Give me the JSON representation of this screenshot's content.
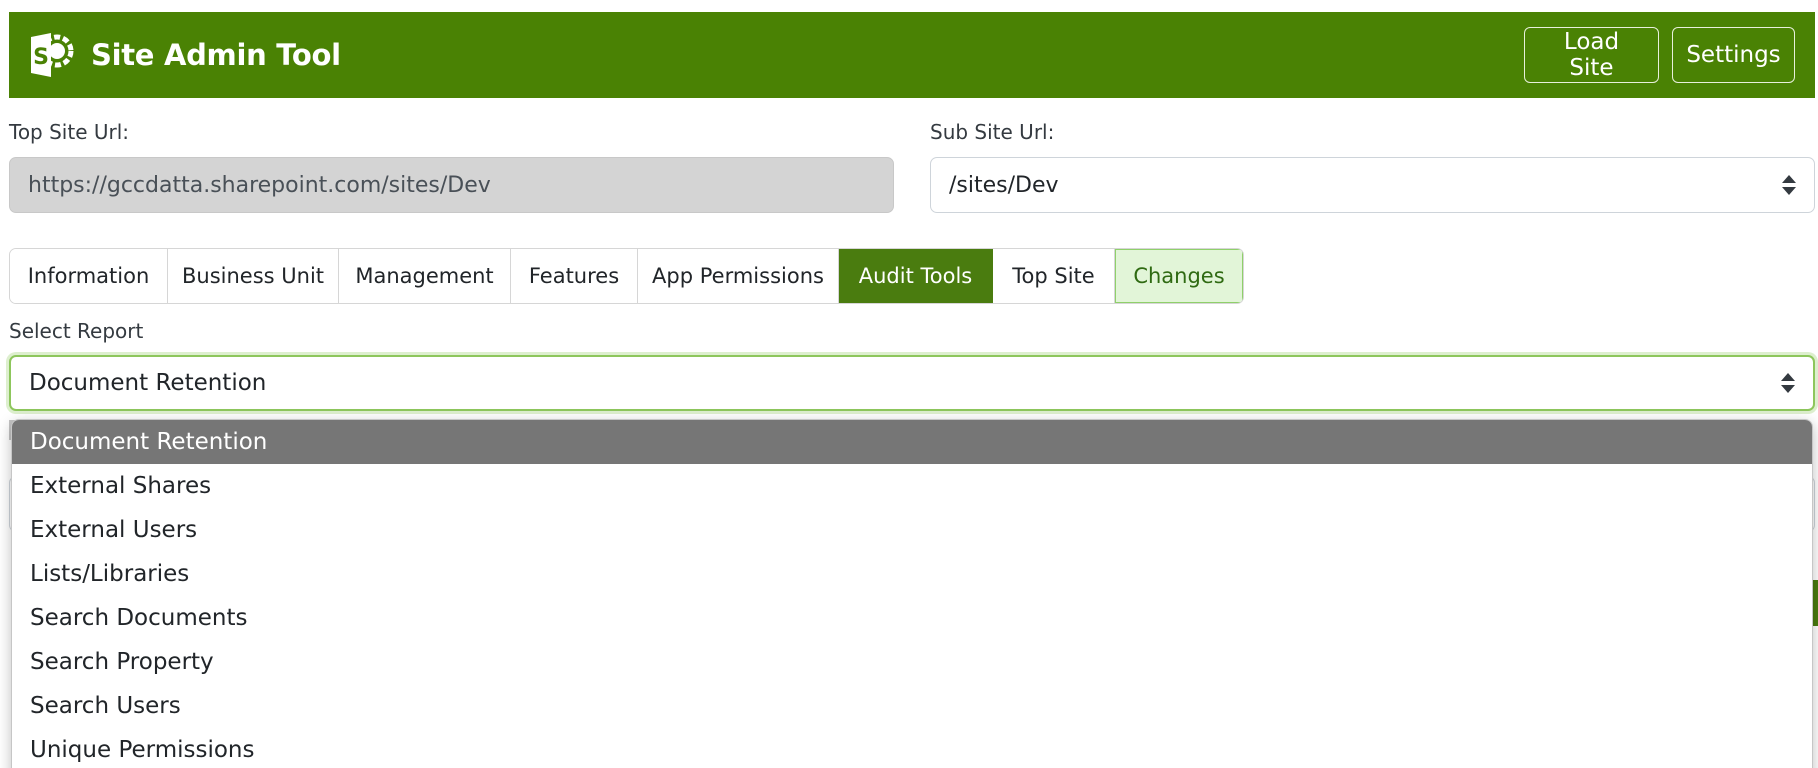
{
  "header": {
    "title": "Site Admin Tool",
    "logo_icon": "sharepoint-logo-icon",
    "load_site_label": "Load Site",
    "settings_label": "Settings",
    "bg_color": "#4a8204"
  },
  "top_site": {
    "label": "Top Site Url:",
    "value": "https://gccdatta.sharepoint.com/sites/Dev"
  },
  "sub_site": {
    "label": "Sub Site Url:",
    "value": "/sites/Dev"
  },
  "tabs": [
    {
      "label": "Information"
    },
    {
      "label": "Business Unit"
    },
    {
      "label": "Management"
    },
    {
      "label": "Features"
    },
    {
      "label": "App Permissions"
    },
    {
      "label": "Audit Tools"
    },
    {
      "label": "Top Site"
    },
    {
      "label": "Changes"
    }
  ],
  "active_tab": "Audit Tools",
  "report": {
    "label": "Select Report",
    "value": "Document Retention",
    "options": [
      "Document Retention",
      "External Shares",
      "External Users",
      "Lists/Libraries",
      "Search Documents",
      "Search Property",
      "Search Users",
      "Unique Permissions"
    ]
  }
}
